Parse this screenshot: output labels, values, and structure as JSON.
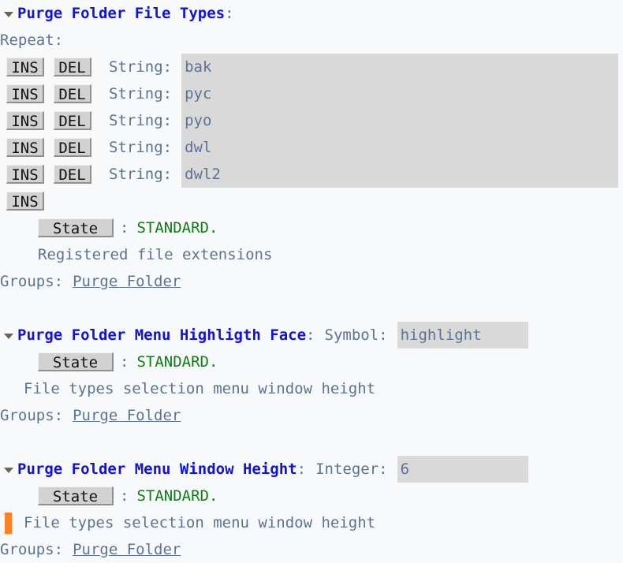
{
  "buffer": {
    "kind": "emacs-customize-buffer",
    "background_color": "#f8f9fb",
    "title_color": "#1414d0",
    "text_color": "#5c7391",
    "field_color": "#d9d9d9",
    "state_value_color": "#137a13",
    "cursor_color": "#fc8224"
  },
  "sections": [
    {
      "id": "purge-folder-file-types",
      "twisty": "triangle-down-icon",
      "title": "Purge Folder File Types",
      "title_colon": ":",
      "repeat_label": "Repeat:",
      "rows": [
        {
          "ins": "INS",
          "del": "DEL",
          "type_label": "String:",
          "value": "bak"
        },
        {
          "ins": "INS",
          "del": "DEL",
          "type_label": "String:",
          "value": "pyc"
        },
        {
          "ins": "INS",
          "del": "DEL",
          "type_label": "String:",
          "value": "pyo"
        },
        {
          "ins": "INS",
          "del": "DEL",
          "type_label": "String:",
          "value": "dwl"
        },
        {
          "ins": "INS",
          "del": "DEL",
          "type_label": "String:",
          "value": "dwl2"
        }
      ],
      "trailing_ins": "INS",
      "state_label": "State",
      "state_sep": ":",
      "state_value": "STANDARD.",
      "doc": "Registered file extensions",
      "groups_label": "Groups:",
      "groups_link": "Purge Folder",
      "has_cursor": false
    },
    {
      "id": "purge-folder-menu-highligth-face",
      "twisty": "triangle-down-icon",
      "title": "Purge Folder Menu Highligth Face",
      "title_colon": ":",
      "type_label": "Symbol:",
      "value": "highlight",
      "state_label": "State",
      "state_sep": ":",
      "state_value": "STANDARD.",
      "doc": "File types selection menu window height",
      "groups_label": "Groups:",
      "groups_link": "Purge Folder",
      "has_cursor": false
    },
    {
      "id": "purge-folder-menu-window-height",
      "twisty": "triangle-down-icon",
      "title": "Purge Folder Menu Window Height",
      "title_colon": ":",
      "type_label": "Integer:",
      "value": "6",
      "state_label": "State",
      "state_sep": ":",
      "state_value": "STANDARD.",
      "doc": "File types selection menu window height",
      "groups_label": "Groups:",
      "groups_link": "Purge Folder",
      "has_cursor": true
    }
  ]
}
